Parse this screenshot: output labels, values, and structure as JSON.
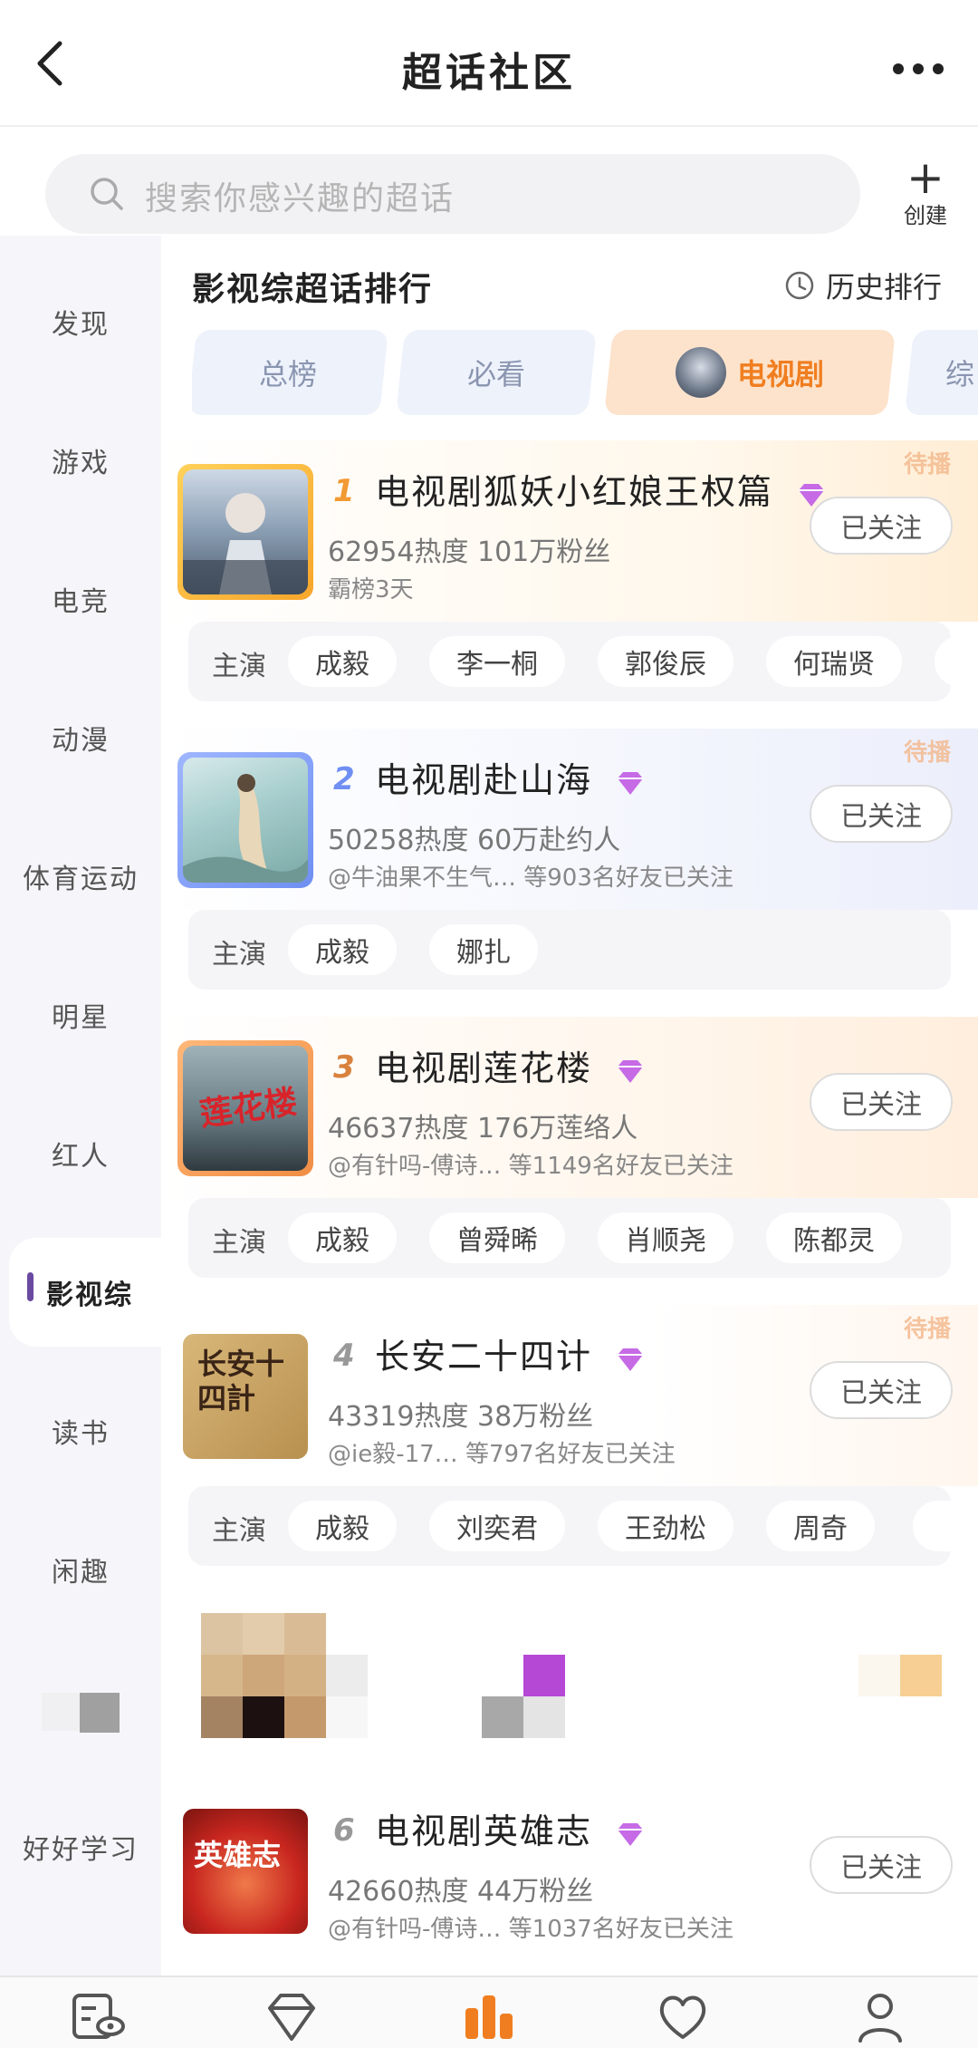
{
  "header": {
    "title": "超话社区"
  },
  "search": {
    "placeholder": "搜索你感兴趣的超话",
    "create_label": "创建"
  },
  "sidebar": {
    "items": [
      {
        "label": "发现"
      },
      {
        "label": "游戏"
      },
      {
        "label": "电竞"
      },
      {
        "label": "动漫"
      },
      {
        "label": "体育运动"
      },
      {
        "label": "明星"
      },
      {
        "label": "红人"
      },
      {
        "label": "影视综",
        "active": true
      },
      {
        "label": "读书"
      },
      {
        "label": "闲趣"
      },
      {
        "label": ""
      },
      {
        "label": "好好学习"
      }
    ]
  },
  "section": {
    "title": "影视综超话排行",
    "history_label": "历史排行"
  },
  "tabs": [
    {
      "label": "总榜"
    },
    {
      "label": "必看"
    },
    {
      "label": "电视剧",
      "active": true
    },
    {
      "label": "综"
    }
  ],
  "ranking": [
    {
      "rank": "1",
      "name": "电视剧狐妖小红娘王权篇",
      "heat": "62954热度",
      "fans": "101万粉丝",
      "sub": "霸榜3天",
      "badge": "待播",
      "follow_label": "已关注",
      "cast_label": "主演",
      "cast": [
        "成毅",
        "李一桐",
        "郭俊辰",
        "何瑞贤"
      ]
    },
    {
      "rank": "2",
      "name": "电视剧赴山海",
      "heat": "50258热度",
      "fans": "60万赴约人",
      "sub": "@牛油果不生气… 等903名好友已关注",
      "badge": "待播",
      "follow_label": "已关注",
      "cast_label": "主演",
      "cast": [
        "成毅",
        "娜扎"
      ]
    },
    {
      "rank": "3",
      "name": "电视剧莲花楼",
      "heat": "46637热度",
      "fans": "176万莲络人",
      "sub": "@有针吗-傅诗… 等1149名好友已关注",
      "badge": "",
      "follow_label": "已关注",
      "cast_label": "主演",
      "cast": [
        "成毅",
        "曾舜晞",
        "肖顺尧",
        "陈都灵"
      ]
    },
    {
      "rank": "4",
      "name": "长安二十四计",
      "heat": "43319热度",
      "fans": "38万粉丝",
      "sub": "@ie毅-17… 等797名好友已关注",
      "badge": "待播",
      "follow_label": "已关注",
      "cast_label": "主演",
      "cast": [
        "成毅",
        "刘奕君",
        "王劲松",
        "周奇"
      ]
    },
    {
      "rank": "6",
      "name": "电视剧英雄志",
      "heat": "42660热度",
      "fans": "44万粉丝",
      "sub": "@有针吗-傅诗… 等1037名好友已关注",
      "badge": "",
      "follow_label": "已关注",
      "cast_label": "",
      "cast": []
    }
  ],
  "cover_text": {
    "c3": "莲花楼",
    "c4": "长安十四計",
    "c6": "英雄志"
  },
  "colors": {
    "accent": "#f07e20",
    "sidebar_marker": "#6a4aa0",
    "gem": "#b04fd6"
  },
  "bottom_nav": [
    {
      "icon": "feed-eye-icon"
    },
    {
      "icon": "diamond-icon"
    },
    {
      "icon": "rank-bars-icon",
      "active": true
    },
    {
      "icon": "heart-icon"
    },
    {
      "icon": "profile-icon"
    }
  ]
}
